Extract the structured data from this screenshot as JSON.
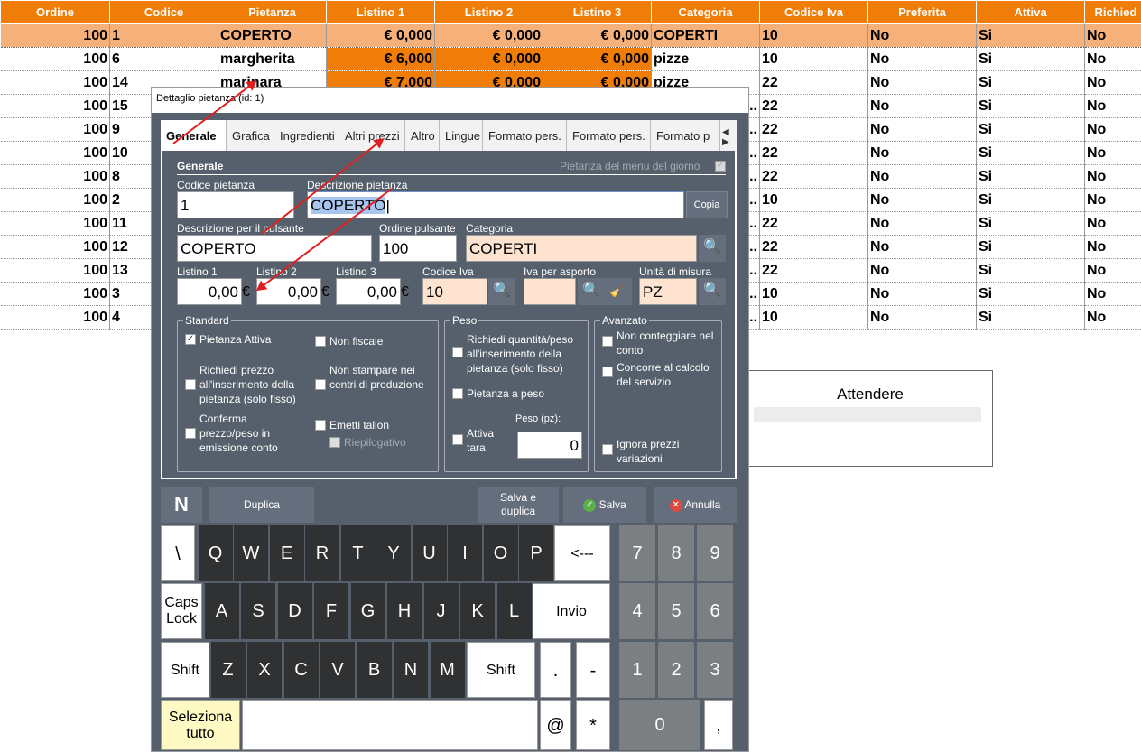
{
  "grid": {
    "headers": [
      "Ordine",
      "Codice",
      "Pietanza",
      "Listino 1",
      "Listino 2",
      "Listino 3",
      "Categoria",
      "Codice Iva",
      "Preferita",
      "Attiva",
      "Richied"
    ],
    "rows": [
      [
        "100",
        "1",
        "COPERTO",
        "€ 0,000",
        "€ 0,000",
        "€ 0,000",
        "COPERTI",
        "10",
        "No",
        "Si",
        "No"
      ],
      [
        "100",
        "6",
        "margherita",
        "€ 6,000",
        "€ 0,000",
        "€ 0,000",
        "pizze",
        "10",
        "No",
        "Si",
        "No"
      ],
      [
        "100",
        "14",
        "marinara",
        "€ 7,000",
        "€ 0,000",
        "€ 0,000",
        "pizze",
        "22",
        "No",
        "Si",
        "No"
      ],
      [
        "100",
        "15",
        "",
        "",
        "",
        "",
        "",
        "22",
        "No",
        "Si",
        "No"
      ],
      [
        "100",
        "9",
        "",
        "",
        "",
        "",
        "",
        "22",
        "No",
        "Si",
        "No"
      ],
      [
        "100",
        "10",
        "",
        "",
        "",
        "",
        "",
        "22",
        "No",
        "Si",
        "No"
      ],
      [
        "100",
        "8",
        "",
        "",
        "",
        "",
        "",
        "22",
        "No",
        "Si",
        "No"
      ],
      [
        "100",
        "2",
        "",
        "",
        "",
        "",
        "",
        "10",
        "No",
        "Si",
        "No"
      ],
      [
        "100",
        "11",
        "",
        "",
        "",
        "",
        "",
        "22",
        "No",
        "Si",
        "No"
      ],
      [
        "100",
        "12",
        "",
        "",
        "",
        "",
        "",
        "22",
        "No",
        "Si",
        "No"
      ],
      [
        "100",
        "13",
        "",
        "",
        "",
        "",
        "",
        "22",
        "No",
        "Si",
        "No"
      ],
      [
        "100",
        "3",
        "",
        "",
        "",
        "",
        "",
        "10",
        "No",
        "Si",
        "No"
      ],
      [
        "100",
        "4",
        "",
        "",
        "",
        "",
        "",
        "10",
        "No",
        "Si",
        "No"
      ]
    ],
    "overflow_marker": ".."
  },
  "attendere": {
    "label": "Attendere"
  },
  "dialog": {
    "title": "Dettaglio pietanza (id: 1)",
    "tabs": [
      "Generale",
      "Grafica",
      "Ingredienti",
      "Altri prezzi",
      "Altro",
      "Lingue",
      "Formato pers.",
      "Formato pers.",
      "Formato p"
    ],
    "section": "Generale",
    "menu_giorno_label": "Pietanza del menu del giorno",
    "codice_label": "Codice pietanza",
    "codice_value": "1",
    "descrizione_label": "Descrizione pietanza",
    "descrizione_value": "COPERTO",
    "copia_label": "Copia",
    "pulsante_label": "Descrizione per il pulsante",
    "pulsante_value": "COPERTO",
    "ordine_label": "Ordine pulsante",
    "ordine_value": "100",
    "categoria_label": "Categoria",
    "categoria_value": "COPERTI",
    "listino1_label": "Listino 1",
    "listino1_value": "0,00",
    "listino2_label": "Listino 2",
    "listino2_value": "0,00",
    "listino3_label": "Listino 3",
    "listino3_value": "0,00",
    "euro": "€",
    "iva_label": "Codice Iva",
    "iva_value": "10",
    "asporto_label": "Iva per asporto",
    "asporto_value": "",
    "unita_label": "Unità di misura",
    "unita_value": "PZ",
    "standard": {
      "title": "Standard",
      "attiva": "Pietanza Attiva",
      "non_fiscale": "Non fiscale",
      "richiedi_prezzo": "Richiedi prezzo all'inserimento della pietanza (solo fisso)",
      "non_stampare": "Non stampare nei centri di produzione",
      "conferma": "Conferma prezzo/peso in emissione conto",
      "emetti": "Emetti tallon",
      "riepilogativo": "Riepilogativo"
    },
    "peso": {
      "title": "Peso",
      "richiedi_qta": "Richiedi quantità/peso all'inserimento della pietanza (solo fisso)",
      "pietanza_peso": "Pietanza a peso",
      "attiva_tara": "Attiva tara",
      "peso_pz_label": "Peso (pz):",
      "peso_pz_value": "0"
    },
    "avanzato": {
      "title": "Avanzato",
      "non_conteggiare": "Non conteggiare nel conto",
      "concorre": "Concorre al calcolo del servizio",
      "ignora": "Ignora prezzi variazioni"
    },
    "toolbar": {
      "n": "N",
      "duplica": "Duplica",
      "salva_duplica": "Salva e duplica",
      "salva": "Salva",
      "annulla": "Annulla"
    },
    "keyboard": {
      "row1": [
        "\\",
        "Q",
        "W",
        "E",
        "R",
        "T",
        "Y",
        "U",
        "I",
        "O",
        "P",
        "<---"
      ],
      "row2": [
        "Caps Lock",
        "A",
        "S",
        "D",
        "F",
        "G",
        "H",
        "J",
        "K",
        "L",
        "Invio"
      ],
      "row3": [
        "Shift",
        "Z",
        "X",
        "C",
        "V",
        "B",
        "N",
        "M",
        "Shift",
        ".",
        "-"
      ],
      "row4": [
        "Seleziona tutto",
        "",
        "@",
        "*"
      ],
      "numpad": [
        "7",
        "8",
        "9",
        "4",
        "5",
        "6",
        "1",
        "2",
        "3",
        "0",
        ","
      ]
    }
  }
}
